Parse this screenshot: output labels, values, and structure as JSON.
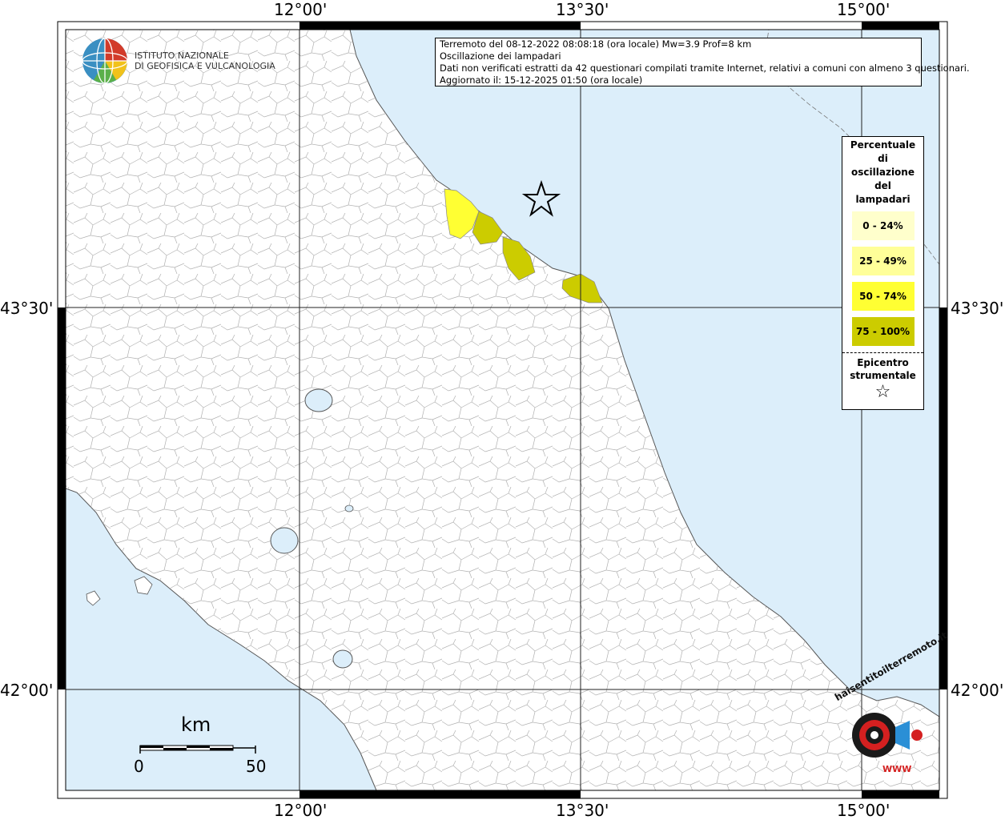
{
  "map": {
    "axis_labels": {
      "top": [
        "12°00'",
        "13°30'",
        "15°00'"
      ],
      "bottom": [
        "12°00'",
        "13°30'",
        "15°00'"
      ],
      "left": [
        "43°30'",
        "42°00'"
      ],
      "right": [
        "43°30'",
        "42°00'"
      ]
    },
    "colors": {
      "sea": "#dceefa",
      "land": "#ffffff",
      "frame": "#000000",
      "borders": "#999999",
      "level_0_24": "#ffffcc",
      "level_25_49": "#ffff99",
      "level_50_74": "#ffff33",
      "level_75_100": "#cccc00"
    }
  },
  "info_box": {
    "line1": "Terremoto del 08-12-2022 08:08:18 (ora locale) Mw=3.9 Prof=8 km",
    "line2": "Oscillazione dei lampadari",
    "line3": "Dati non verificati estratti da 42 questionari compilati tramite Internet, relativi a comuni con almeno 3 questionari.",
    "line4": "Aggiornato il: 15-12-2025 01:50 (ora locale)"
  },
  "logo": {
    "line1": "ISTITUTO NAZIONALE",
    "line2": "DI GEOFISICA E VULCANOLOGIA"
  },
  "legend": {
    "title_lines": [
      "Percentuale",
      "di",
      "oscillazione",
      "del",
      "lampadari"
    ],
    "items": [
      {
        "label": "0 - 24%",
        "color": "#ffffcc"
      },
      {
        "label": "25 - 49%",
        "color": "#ffff99"
      },
      {
        "label": "50 - 74%",
        "color": "#ffff33"
      },
      {
        "label": "75 - 100%",
        "color": "#cccc00"
      }
    ],
    "epicenter_lines": [
      "Epicentro",
      "strumentale"
    ],
    "epicenter_symbol": "☆"
  },
  "scale_bar": {
    "unit": "km",
    "min_label": "0",
    "max_label": "50"
  },
  "stamp": {
    "text": "haisentitoilterremoto.it",
    "small": "WWW"
  }
}
